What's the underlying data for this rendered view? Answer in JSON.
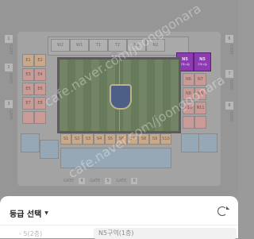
{
  "map": {
    "gates_left": [
      "GATE",
      "GATE",
      "GATE"
    ],
    "gates_left_nums": [
      "1",
      "2",
      "3"
    ],
    "gates_right": [
      "GATE",
      "GATE",
      "GATE"
    ],
    "gates_right_nums": [
      "6",
      "7",
      "8"
    ],
    "gates_bottom": {
      "label": "GATE",
      "nums": [
        "4",
        "5",
        "6"
      ]
    },
    "top_sections": [
      "W2",
      "W1",
      "T1",
      "T2",
      "N1",
      "N2"
    ],
    "center_top_label": "T",
    "highlighted": [
      {
        "name": "N5",
        "sub": "구역(1층)"
      },
      {
        "name": "N5",
        "sub": "구역(1층)"
      }
    ],
    "left_sections": [
      "E1",
      "E2",
      "E3",
      "E4",
      "E5",
      "E6",
      "E7",
      "E8"
    ],
    "right_sections": [
      "N6",
      "N7",
      "N8",
      "N9",
      "N10",
      "N11"
    ],
    "bottom_sections": [
      "S1",
      "S2",
      "S3",
      "S4",
      "S5",
      "S6",
      "S7",
      "S8",
      "S9",
      "S10"
    ],
    "watermarks": [
      "cafe.naver.com/joonggonara",
      "cafe.naver.com/joonggonara"
    ]
  },
  "sheet": {
    "grade_select": "등급 선택",
    "left_hint": "- 5(2층)",
    "section_value": "N5구역(1층)"
  }
}
